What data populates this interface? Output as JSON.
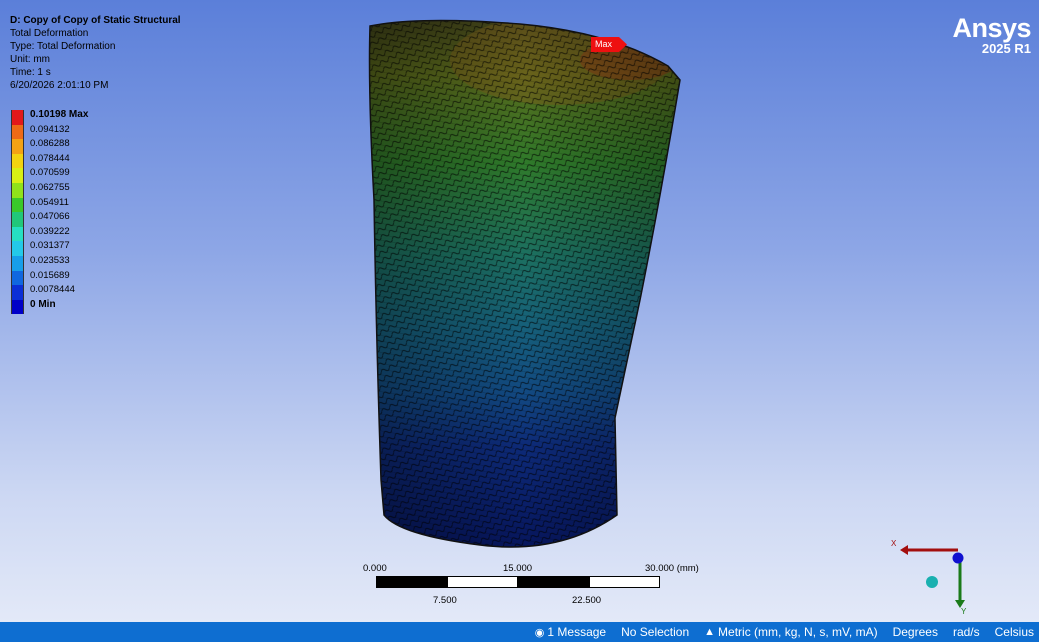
{
  "header": {
    "title": "D: Copy of Copy of Static Structural",
    "lines": [
      "Total Deformation",
      "Type: Total Deformation",
      "Unit: mm",
      "Time: 1 s",
      "6/20/2026 2:01:10 PM"
    ]
  },
  "legend": {
    "entries": [
      {
        "label": "0.10198 Max",
        "color": "#e3181a"
      },
      {
        "label": "0.094132",
        "color": "#ee6a16"
      },
      {
        "label": "0.086288",
        "color": "#f3a214"
      },
      {
        "label": "0.078444",
        "color": "#f2d310"
      },
      {
        "label": "0.070599",
        "color": "#d8ef14"
      },
      {
        "label": "0.062755",
        "color": "#90e21a"
      },
      {
        "label": "0.054911",
        "color": "#39c92a"
      },
      {
        "label": "0.047066",
        "color": "#21c77a"
      },
      {
        "label": "0.039222",
        "color": "#26dfc2"
      },
      {
        "label": "0.031377",
        "color": "#23c9e8"
      },
      {
        "label": "0.023533",
        "color": "#179ee9"
      },
      {
        "label": "0.015689",
        "color": "#1067e0"
      },
      {
        "label": "0.0078444",
        "color": "#0b2fd6"
      },
      {
        "label": "0 Min",
        "color": "#0000c8"
      }
    ]
  },
  "brand": {
    "name": "Ansys",
    "version": "2025 R1"
  },
  "probe": {
    "label": "Max"
  },
  "scale_bar": {
    "top_labels": [
      "0.000",
      "15.000",
      "30.000 (mm)"
    ],
    "bottom_labels": [
      "7.500",
      "22.500"
    ]
  },
  "triad": {
    "x_label": "X",
    "y_label": "Y"
  },
  "status_bar": {
    "message": "1 Message",
    "selection": "No Selection",
    "units": "Metric (mm, kg, N, s, mV, mA)",
    "angle": "Degrees",
    "angular_velocity": "rad/s",
    "temperature": "Celsius"
  },
  "colors": {
    "status_bar_bg": "#0e6ed1",
    "background_top": "#5b7fd9",
    "background_bottom": "#e3e9f8"
  }
}
